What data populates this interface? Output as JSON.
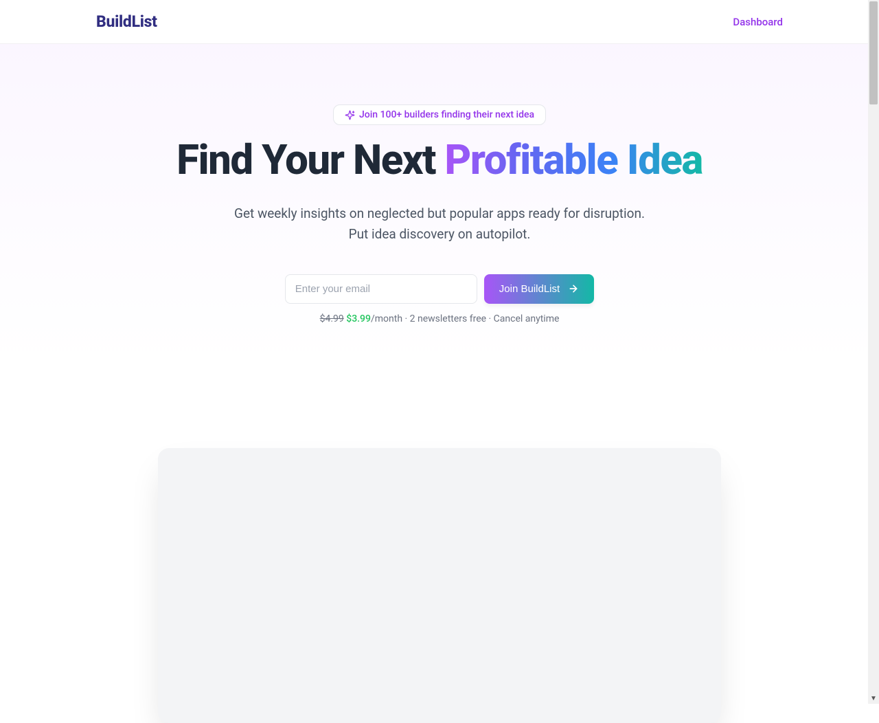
{
  "header": {
    "logo": "BuildList",
    "dashboard_link": "Dashboard"
  },
  "hero": {
    "badge_text": "Join 100+ builders finding their next idea",
    "headline_prefix": "Find Your Next ",
    "headline_gradient": "Profitable Idea",
    "subtitle_line1": "Get weekly insights on neglected but popular apps ready for disruption.",
    "subtitle_line2": "Put idea discovery on autopilot."
  },
  "form": {
    "email_placeholder": "Enter your email",
    "cta_label": "Join BuildList"
  },
  "pricing": {
    "old_price": "$4.99",
    "new_price": "$3.99",
    "suffix": "/month · 2 newsletters free · Cancel anytime"
  }
}
